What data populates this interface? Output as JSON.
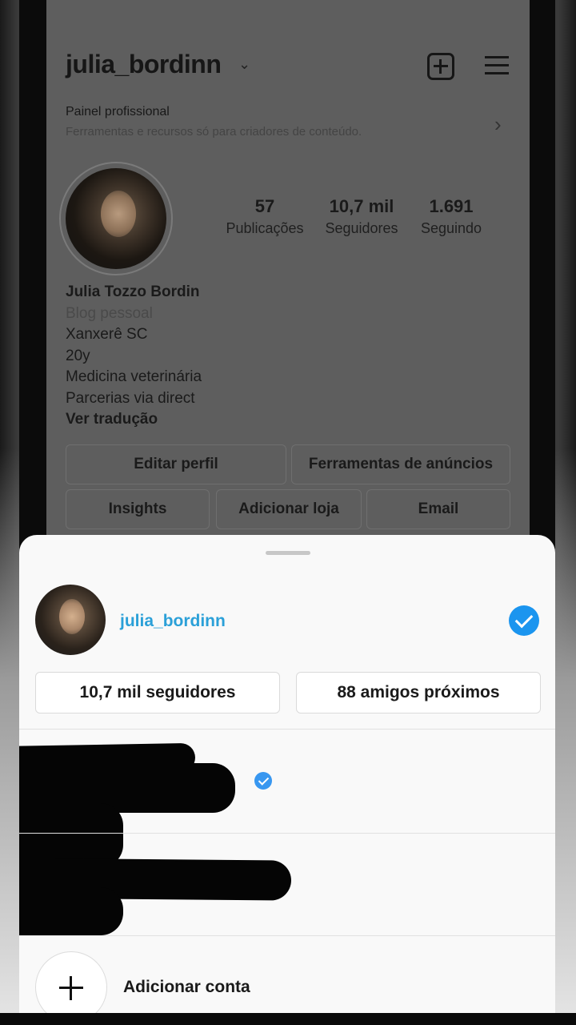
{
  "profile": {
    "username": "julia_bordinn",
    "chevron_icon": "chevron-down-icon",
    "pro_panel": {
      "title": "Painel profissional",
      "subtitle": "Ferramentas e recursos só para criadores de conteúdo."
    },
    "stats": [
      {
        "value": "57",
        "label": "Publicações"
      },
      {
        "value": "10,7 mil",
        "label": "Seguidores"
      },
      {
        "value": "1.691",
        "label": "Seguindo"
      }
    ],
    "bio": {
      "name": "Julia Tozzo Bordin",
      "category": "Blog pessoal",
      "lines": [
        "Xanxerê SC",
        "20y",
        "Medicina veterinária",
        "Parcerias via direct"
      ],
      "translate": "Ver tradução"
    },
    "buttons": {
      "edit": "Editar perfil",
      "ad_tools": "Ferramentas de anúncios",
      "insights": "Insights",
      "add_shop": "Adicionar loja",
      "email": "Email"
    }
  },
  "sheet": {
    "account_username": "julia_bordinn",
    "followers_button": "10,7 mil seguidores",
    "close_friends_button": "88 amigos próximos",
    "add_account": "Adicionar conta"
  },
  "colors": {
    "accent_blue": "#1b95ef",
    "username_link": "#2ba0d8"
  }
}
